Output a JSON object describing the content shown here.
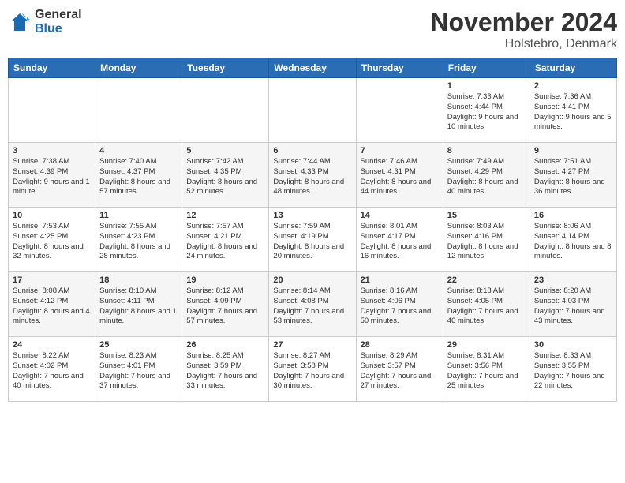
{
  "header": {
    "logo_general": "General",
    "logo_blue": "Blue",
    "month_title": "November 2024",
    "location": "Holstebro, Denmark"
  },
  "weekdays": [
    "Sunday",
    "Monday",
    "Tuesday",
    "Wednesday",
    "Thursday",
    "Friday",
    "Saturday"
  ],
  "weeks": [
    [
      {
        "day": "",
        "info": ""
      },
      {
        "day": "",
        "info": ""
      },
      {
        "day": "",
        "info": ""
      },
      {
        "day": "",
        "info": ""
      },
      {
        "day": "",
        "info": ""
      },
      {
        "day": "1",
        "info": "Sunrise: 7:33 AM\nSunset: 4:44 PM\nDaylight: 9 hours\nand 10 minutes."
      },
      {
        "day": "2",
        "info": "Sunrise: 7:36 AM\nSunset: 4:41 PM\nDaylight: 9 hours\nand 5 minutes."
      }
    ],
    [
      {
        "day": "3",
        "info": "Sunrise: 7:38 AM\nSunset: 4:39 PM\nDaylight: 9 hours\nand 1 minute."
      },
      {
        "day": "4",
        "info": "Sunrise: 7:40 AM\nSunset: 4:37 PM\nDaylight: 8 hours\nand 57 minutes."
      },
      {
        "day": "5",
        "info": "Sunrise: 7:42 AM\nSunset: 4:35 PM\nDaylight: 8 hours\nand 52 minutes."
      },
      {
        "day": "6",
        "info": "Sunrise: 7:44 AM\nSunset: 4:33 PM\nDaylight: 8 hours\nand 48 minutes."
      },
      {
        "day": "7",
        "info": "Sunrise: 7:46 AM\nSunset: 4:31 PM\nDaylight: 8 hours\nand 44 minutes."
      },
      {
        "day": "8",
        "info": "Sunrise: 7:49 AM\nSunset: 4:29 PM\nDaylight: 8 hours\nand 40 minutes."
      },
      {
        "day": "9",
        "info": "Sunrise: 7:51 AM\nSunset: 4:27 PM\nDaylight: 8 hours\nand 36 minutes."
      }
    ],
    [
      {
        "day": "10",
        "info": "Sunrise: 7:53 AM\nSunset: 4:25 PM\nDaylight: 8 hours\nand 32 minutes."
      },
      {
        "day": "11",
        "info": "Sunrise: 7:55 AM\nSunset: 4:23 PM\nDaylight: 8 hours\nand 28 minutes."
      },
      {
        "day": "12",
        "info": "Sunrise: 7:57 AM\nSunset: 4:21 PM\nDaylight: 8 hours\nand 24 minutes."
      },
      {
        "day": "13",
        "info": "Sunrise: 7:59 AM\nSunset: 4:19 PM\nDaylight: 8 hours\nand 20 minutes."
      },
      {
        "day": "14",
        "info": "Sunrise: 8:01 AM\nSunset: 4:17 PM\nDaylight: 8 hours\nand 16 minutes."
      },
      {
        "day": "15",
        "info": "Sunrise: 8:03 AM\nSunset: 4:16 PM\nDaylight: 8 hours\nand 12 minutes."
      },
      {
        "day": "16",
        "info": "Sunrise: 8:06 AM\nSunset: 4:14 PM\nDaylight: 8 hours\nand 8 minutes."
      }
    ],
    [
      {
        "day": "17",
        "info": "Sunrise: 8:08 AM\nSunset: 4:12 PM\nDaylight: 8 hours\nand 4 minutes."
      },
      {
        "day": "18",
        "info": "Sunrise: 8:10 AM\nSunset: 4:11 PM\nDaylight: 8 hours\nand 1 minute."
      },
      {
        "day": "19",
        "info": "Sunrise: 8:12 AM\nSunset: 4:09 PM\nDaylight: 7 hours\nand 57 minutes."
      },
      {
        "day": "20",
        "info": "Sunrise: 8:14 AM\nSunset: 4:08 PM\nDaylight: 7 hours\nand 53 minutes."
      },
      {
        "day": "21",
        "info": "Sunrise: 8:16 AM\nSunset: 4:06 PM\nDaylight: 7 hours\nand 50 minutes."
      },
      {
        "day": "22",
        "info": "Sunrise: 8:18 AM\nSunset: 4:05 PM\nDaylight: 7 hours\nand 46 minutes."
      },
      {
        "day": "23",
        "info": "Sunrise: 8:20 AM\nSunset: 4:03 PM\nDaylight: 7 hours\nand 43 minutes."
      }
    ],
    [
      {
        "day": "24",
        "info": "Sunrise: 8:22 AM\nSunset: 4:02 PM\nDaylight: 7 hours\nand 40 minutes."
      },
      {
        "day": "25",
        "info": "Sunrise: 8:23 AM\nSunset: 4:01 PM\nDaylight: 7 hours\nand 37 minutes."
      },
      {
        "day": "26",
        "info": "Sunrise: 8:25 AM\nSunset: 3:59 PM\nDaylight: 7 hours\nand 33 minutes."
      },
      {
        "day": "27",
        "info": "Sunrise: 8:27 AM\nSunset: 3:58 PM\nDaylight: 7 hours\nand 30 minutes."
      },
      {
        "day": "28",
        "info": "Sunrise: 8:29 AM\nSunset: 3:57 PM\nDaylight: 7 hours\nand 27 minutes."
      },
      {
        "day": "29",
        "info": "Sunrise: 8:31 AM\nSunset: 3:56 PM\nDaylight: 7 hours\nand 25 minutes."
      },
      {
        "day": "30",
        "info": "Sunrise: 8:33 AM\nSunset: 3:55 PM\nDaylight: 7 hours\nand 22 minutes."
      }
    ]
  ]
}
